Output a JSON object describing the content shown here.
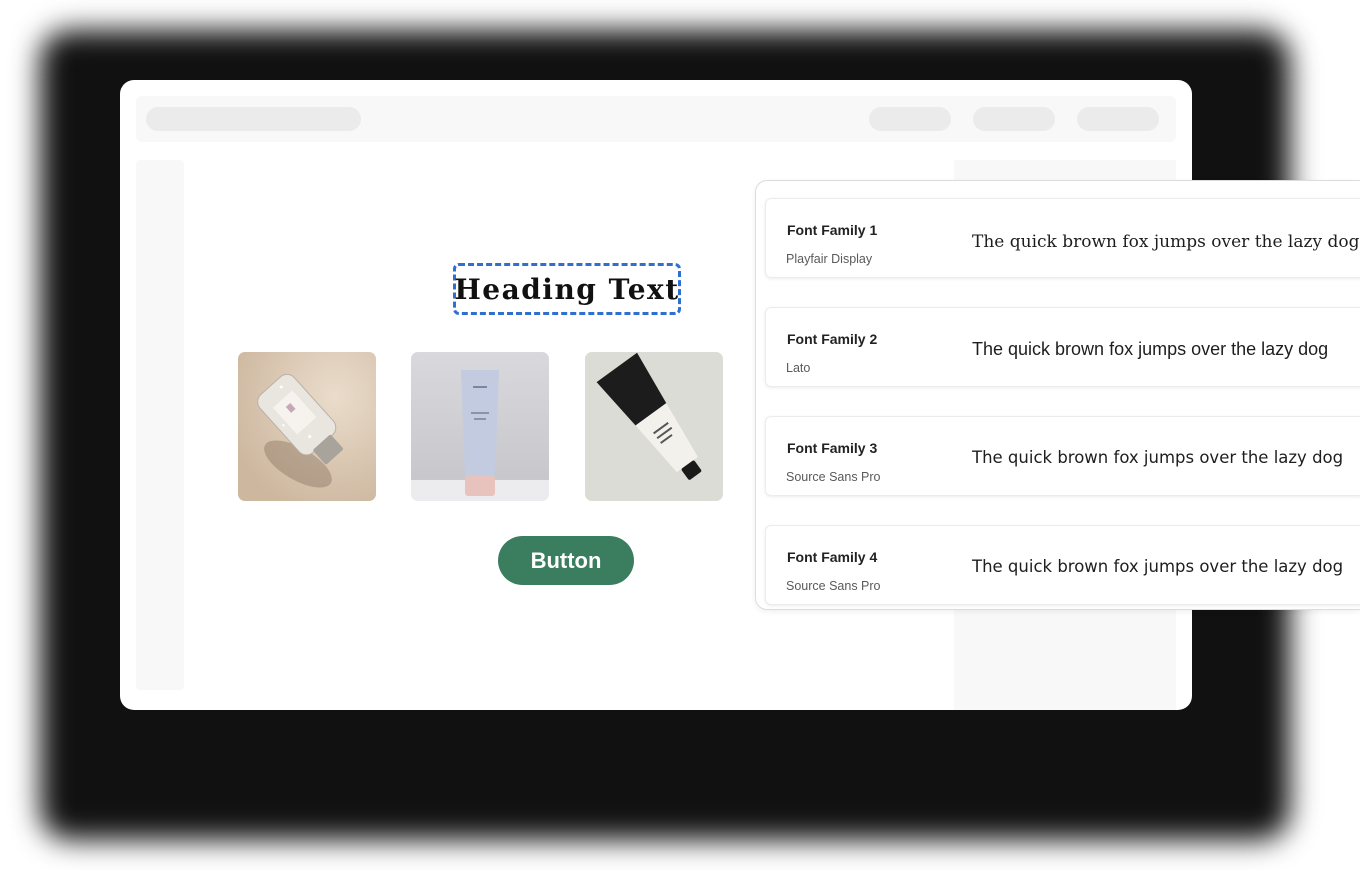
{
  "canvas": {
    "heading": "Heading Text",
    "button_label": "Button",
    "images": [
      {
        "icon": "serum-bottle-image"
      },
      {
        "icon": "cream-tube-image"
      },
      {
        "icon": "black-tube-image"
      }
    ]
  },
  "font_panel": {
    "rows": [
      {
        "label": "Font Family 1",
        "family": "Playfair Display",
        "sample": "The quick brown fox jumps over the lazy dog"
      },
      {
        "label": "Font Family 2",
        "family": "Lato",
        "sample": "The quick brown fox jumps over the lazy dog"
      },
      {
        "label": "Font Family 3",
        "family": "Source Sans Pro",
        "sample": "The quick brown fox jumps over the lazy dog"
      },
      {
        "label": "Font Family 4",
        "family": "Source Sans Pro",
        "sample": "The quick brown fox jumps over the lazy dog"
      }
    ]
  },
  "colors": {
    "accent_button": "#3b7d5f",
    "selection_outline": "#2f6fd0"
  }
}
